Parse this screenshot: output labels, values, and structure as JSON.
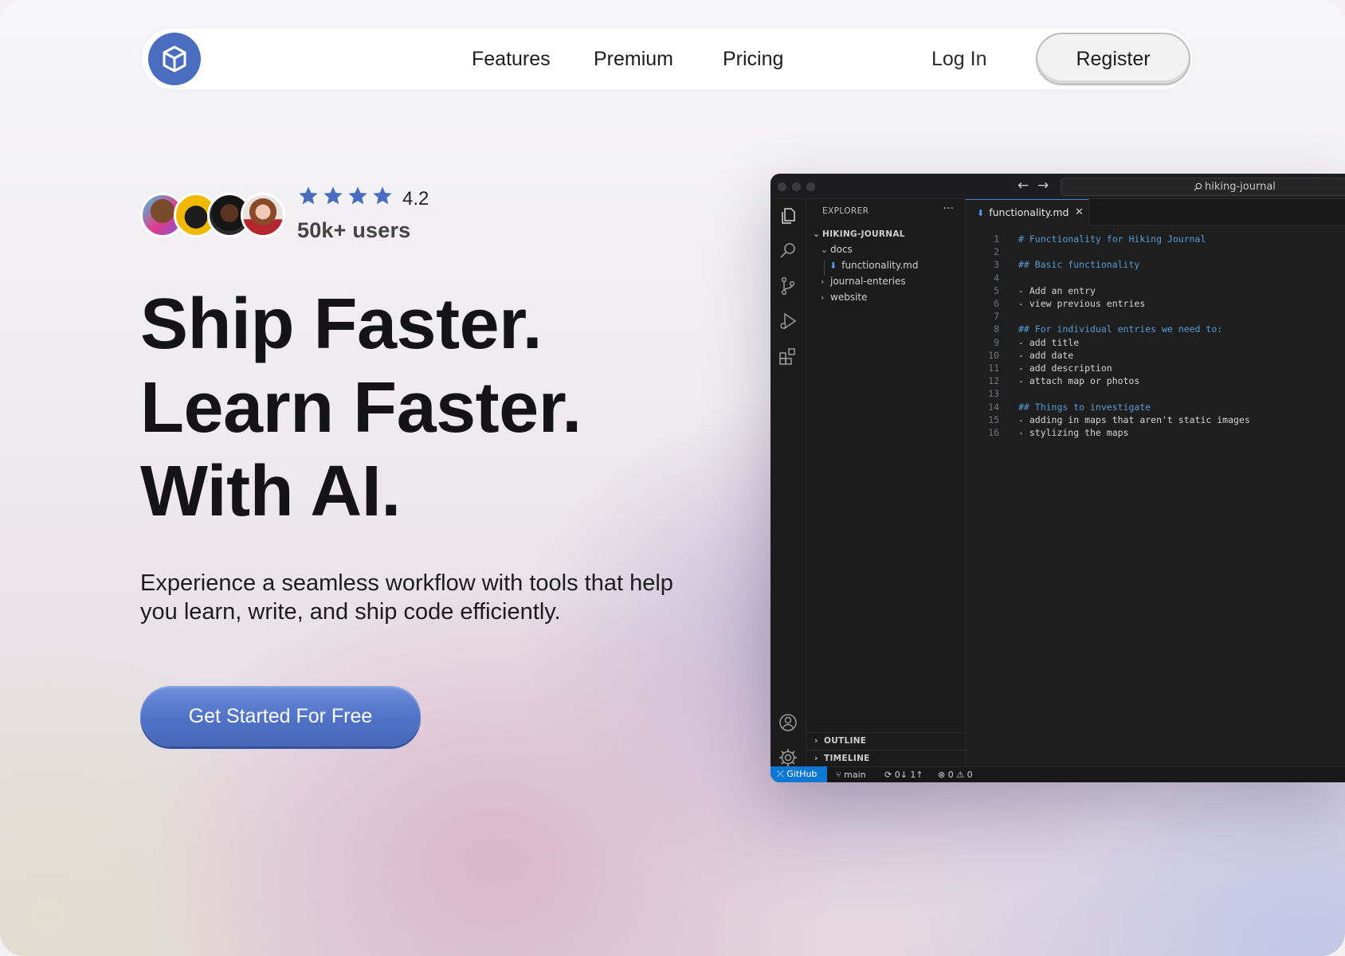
{
  "nav": {
    "links": [
      "Features",
      "Premium",
      "Pricing"
    ],
    "login": "Log In",
    "register": "Register"
  },
  "hero": {
    "rating": "4.2",
    "stars": 4,
    "users": "50k+ users",
    "headline": [
      "Ship Faster.",
      "Learn Faster.",
      "With AI."
    ],
    "subtitle": "Experience a seamless workflow with tools that help you learn, write, and ship code efficiently.",
    "cta": "Get Started For Free"
  },
  "editor": {
    "search": "hiking-journal",
    "explorer": {
      "title": "EXPLORER",
      "more": "···",
      "project": "HIKING-JOURNAL",
      "tree": {
        "docs": "docs",
        "file": "functionality.md",
        "journal": "journal-enteries",
        "website": "website"
      },
      "outline": "OUTLINE",
      "timeline": "TIMELINE"
    },
    "tab": "functionality.md",
    "lines": [
      {
        "n": "1",
        "text": "# Functionality for Hiking Journal",
        "heading": true
      },
      {
        "n": "2",
        "text": "",
        "heading": false
      },
      {
        "n": "3",
        "text": "## Basic functionality",
        "heading": true
      },
      {
        "n": "4",
        "text": "",
        "heading": false
      },
      {
        "n": "5",
        "text": "- Add an entry",
        "heading": false
      },
      {
        "n": "6",
        "text": "- view previous entries",
        "heading": false
      },
      {
        "n": "7",
        "text": "",
        "heading": false
      },
      {
        "n": "8",
        "text": "## For individual entries we need to:",
        "heading": true
      },
      {
        "n": "9",
        "text": "- add title",
        "heading": false
      },
      {
        "n": "10",
        "text": "- add date",
        "heading": false
      },
      {
        "n": "11",
        "text": "- add description",
        "heading": false
      },
      {
        "n": "12",
        "text": "- attach map or photos",
        "heading": false
      },
      {
        "n": "13",
        "text": "",
        "heading": false
      },
      {
        "n": "14",
        "text": "## Things to investigate",
        "heading": true
      },
      {
        "n": "15",
        "text": "- adding in maps that aren't static images",
        "heading": false
      },
      {
        "n": "16",
        "text": "- stylizing the maps",
        "heading": false
      }
    ],
    "status": {
      "remote": "GitHub",
      "branch": "main",
      "sync": "0↓ 1↑",
      "errors": "0",
      "warnings": "0"
    }
  },
  "colors": {
    "accent": "#4a6dbf",
    "star": "#4a6dbf",
    "cta": "#5072c6",
    "remote": "#0e78d3"
  },
  "icons": [
    "cube-icon",
    "star-icon",
    "files-icon",
    "search-icon",
    "source-control-icon",
    "run-debug-icon",
    "extensions-icon",
    "account-icon",
    "settings-icon"
  ]
}
